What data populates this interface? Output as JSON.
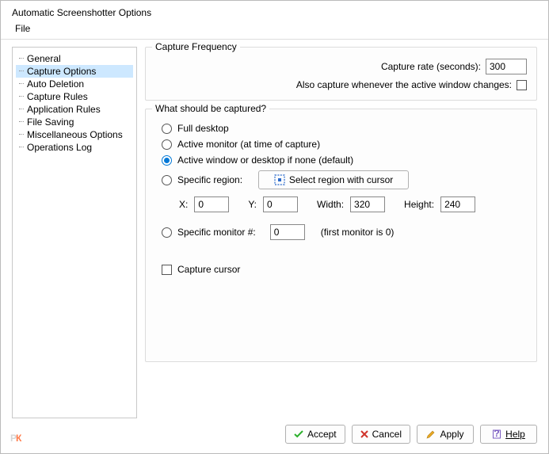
{
  "title": "Automatic Screenshotter Options",
  "menubar": {
    "file": "File"
  },
  "tree": {
    "items": [
      {
        "label": "General"
      },
      {
        "label": "Capture Options",
        "selected": true
      },
      {
        "label": "Auto Deletion"
      },
      {
        "label": "Capture Rules"
      },
      {
        "label": "Application Rules"
      },
      {
        "label": "File Saving"
      },
      {
        "label": "Miscellaneous Options"
      },
      {
        "label": "Operations Log"
      }
    ]
  },
  "capture_frequency": {
    "group_title": "Capture Frequency",
    "rate_label": "Capture rate (seconds):",
    "rate_value": "300",
    "also_label": "Also capture whenever the active window changes:",
    "also_checked": false
  },
  "capture_target": {
    "group_title": "What should be captured?",
    "full_desktop": "Full desktop",
    "active_monitor": "Active monitor (at time of capture)",
    "active_window": "Active window or desktop if none (default)",
    "specific_region": "Specific region:",
    "select_region_btn": "Select region with cursor",
    "x_label": "X:",
    "x_value": "0",
    "y_label": "Y:",
    "y_value": "0",
    "w_label": "Width:",
    "w_value": "320",
    "h_label": "Height:",
    "h_value": "240",
    "specific_monitor": "Specific monitor #:",
    "specific_monitor_value": "0",
    "specific_monitor_hint": "(first monitor is 0)",
    "capture_cursor": "Capture cursor",
    "capture_cursor_checked": false,
    "selected": "active_window"
  },
  "buttons": {
    "accept": "Accept",
    "cancel": "Cancel",
    "apply": "Apply",
    "help": "Help"
  },
  "watermark": {
    "p": "P",
    "r": "К"
  }
}
